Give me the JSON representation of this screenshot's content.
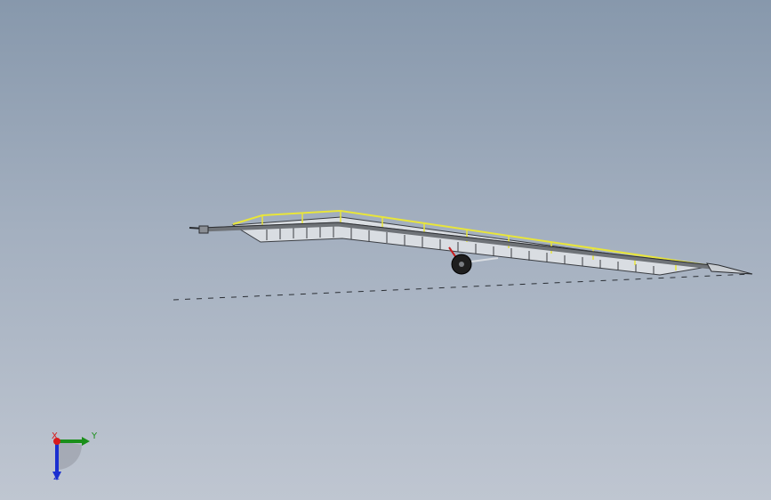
{
  "viewport": {
    "background_top": "#8798ac",
    "background_bottom": "#bfc6d1",
    "model": {
      "rail_color": "#e8e53a",
      "beam_color": "#6f7378",
      "deck_color": "#d9dde2",
      "wheel_color": "#1e1e1e",
      "accent_color": "#c81e1e"
    }
  },
  "triad": {
    "x_label": "X",
    "y_label": "Y",
    "z_label": "Z",
    "x_color": "#d81b1b",
    "y_color": "#1a8f1a",
    "z_color": "#1a2fd0"
  }
}
